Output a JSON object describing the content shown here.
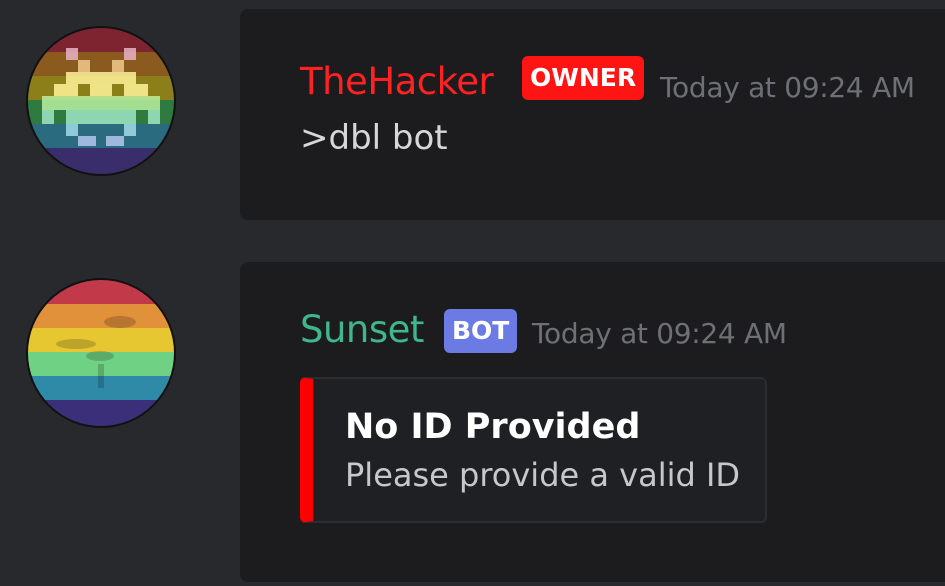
{
  "colors": {
    "background": "#28292c",
    "card": "#1c1c1e",
    "owner_name": "#ff2222",
    "owner_badge": "#ff1414",
    "bot_name": "#3fb68b",
    "bot_badge": "#6b7be3",
    "timestamp": "#6e7076",
    "message_text": "#d7d7d7",
    "embed_bar": "#ff0000",
    "embed_title": "#ffffff",
    "embed_desc": "#c7c8ca"
  },
  "messages": [
    {
      "username": "TheHacker",
      "badge": "OWNER",
      "timestamp": "Today at 09:24 AM",
      "content": ">dbl bot",
      "avatar_icon": "pixel-alien-rainbow-avatar-icon"
    },
    {
      "username": "Sunset",
      "badge": "BOT",
      "timestamp": "Today at 09:24 AM",
      "avatar_icon": "sunset-rainbow-avatar-icon",
      "embed": {
        "title": "No ID Provided",
        "description": "Please provide a valid ID"
      }
    }
  ]
}
